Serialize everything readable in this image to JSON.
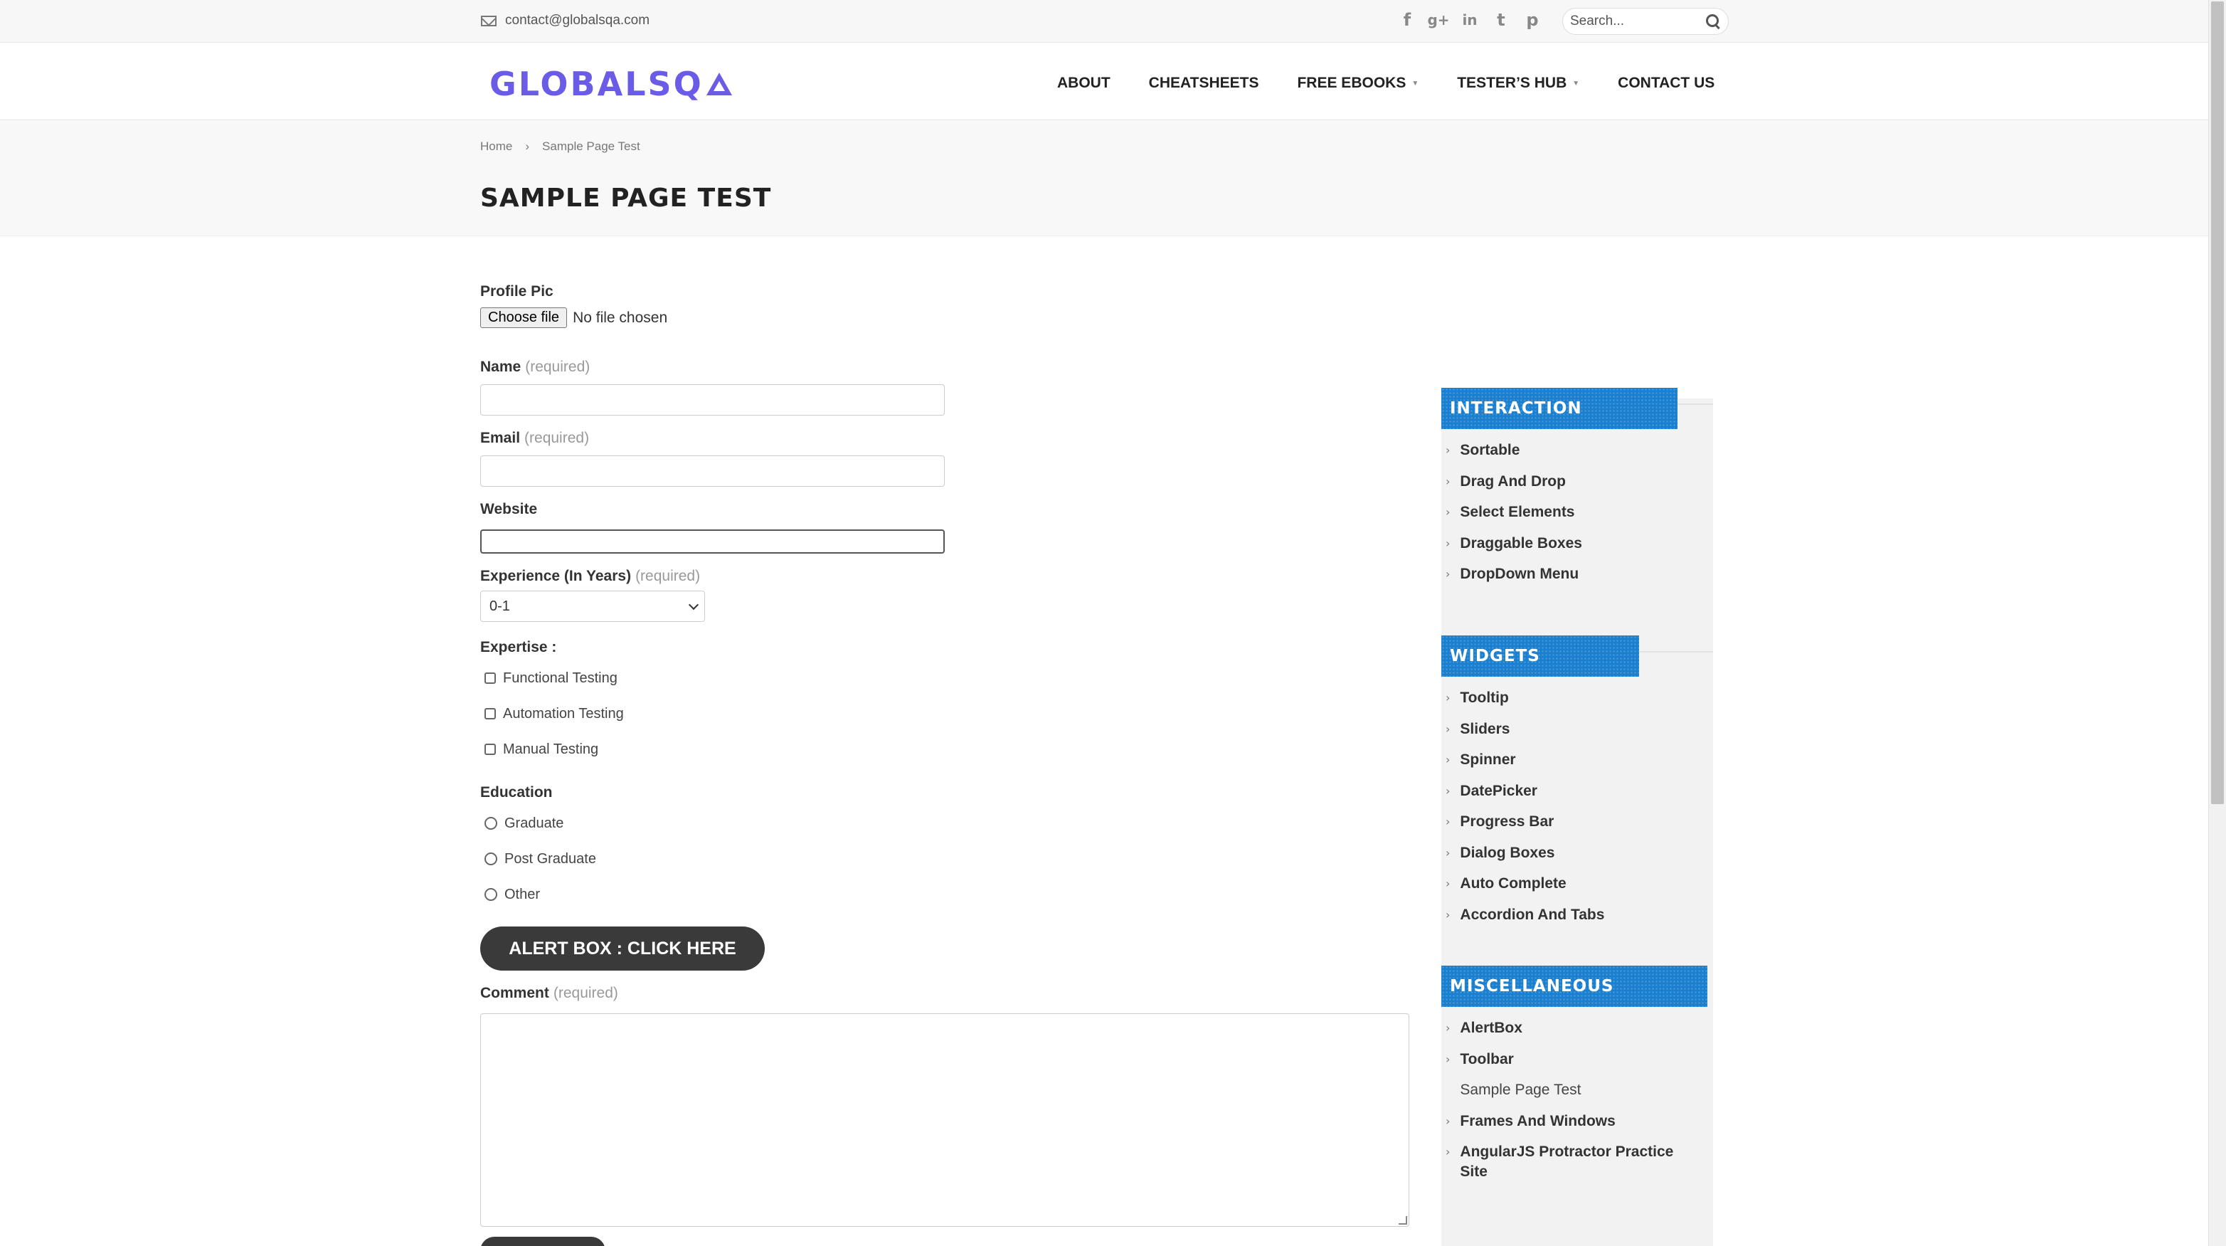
{
  "topbar": {
    "email": "contact@globalsqa.com",
    "social": [
      {
        "icon": "facebook-icon",
        "glyph": "f"
      },
      {
        "icon": "google-plus-icon",
        "glyph": "g+"
      },
      {
        "icon": "linkedin-icon",
        "glyph": "in"
      },
      {
        "icon": "twitter-icon",
        "glyph": "t"
      },
      {
        "icon": "pinterest-icon",
        "glyph": "p"
      }
    ],
    "search_placeholder": "Search..."
  },
  "header": {
    "logo_text": "GLOBALSQ",
    "brand_color": "#6b5ce7",
    "nav": [
      {
        "label": "ABOUT",
        "has_dropdown": false
      },
      {
        "label": "CHEATSHEETS",
        "has_dropdown": false
      },
      {
        "label": "FREE EBOOKS",
        "has_dropdown": true
      },
      {
        "label": "TESTER’S HUB",
        "has_dropdown": true
      },
      {
        "label": "CONTACT US",
        "has_dropdown": false
      }
    ]
  },
  "page": {
    "breadcrumb": [
      "Home",
      "›",
      "Sample Page Test"
    ],
    "title": "SAMPLE PAGE TEST"
  },
  "form": {
    "profile_pic_label": "Profile Pic",
    "choose_file_label": "Choose file",
    "no_file_text": "No file chosen",
    "name_label": "Name",
    "email_label": "Email",
    "website_label": "Website",
    "experience_label": "Experience (In Years)",
    "experience_value": "0-1",
    "required_text": "(required)",
    "expertise_label": "Expertise :",
    "expertise_options": [
      "Functional Testing",
      "Automation Testing",
      "Manual Testing"
    ],
    "education_label": "Education",
    "education_options": [
      "Graduate",
      "Post Graduate",
      "Other"
    ],
    "alert_button_label": "ALERT BOX : CLICK HERE",
    "comment_label": "Comment"
  },
  "sidebar": {
    "accent_color": "#1b7fcf",
    "widgets": [
      {
        "title": "INTERACTION",
        "items": [
          "Sortable",
          "Drag And Drop",
          "Select Elements",
          "Draggable Boxes",
          "DropDown Menu"
        ]
      },
      {
        "title": "WIDGETS",
        "items": [
          "Tooltip",
          "Sliders",
          "Spinner",
          "DatePicker",
          "Progress Bar",
          "Dialog Boxes",
          "Auto Complete",
          "Accordion And Tabs"
        ]
      },
      {
        "title": "MISCELLANEOUS",
        "items": [
          "AlertBox",
          "Toolbar",
          "Sample Page Test",
          "Frames And Windows",
          "AngularJS Protractor Practice Site"
        ],
        "current": "Sample Page Test"
      }
    ]
  }
}
